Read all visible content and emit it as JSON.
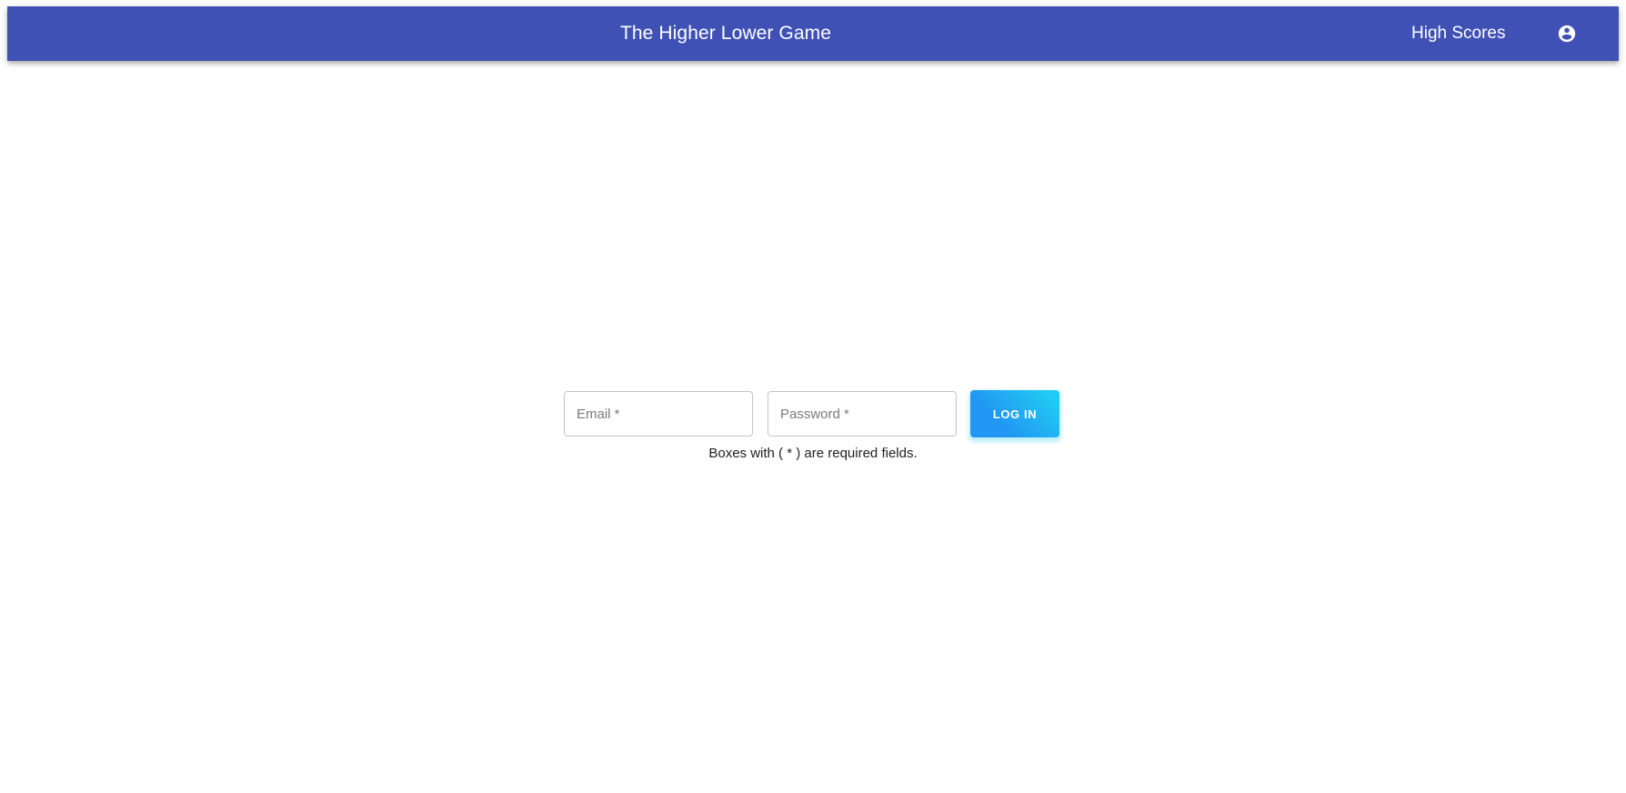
{
  "header": {
    "title": "The Higher Lower Game",
    "nav_high_scores": "High Scores",
    "account_icon": "account-circle-icon",
    "background_color": "#3f51b5"
  },
  "login_form": {
    "email_placeholder": "Email *",
    "email_value": "",
    "password_placeholder": "Password *",
    "password_value": "",
    "submit_label": "LOG IN",
    "helper_text": "Boxes with ( * ) are required fields.",
    "button_gradient": [
      "#2196f3",
      "#21cbf3"
    ]
  }
}
